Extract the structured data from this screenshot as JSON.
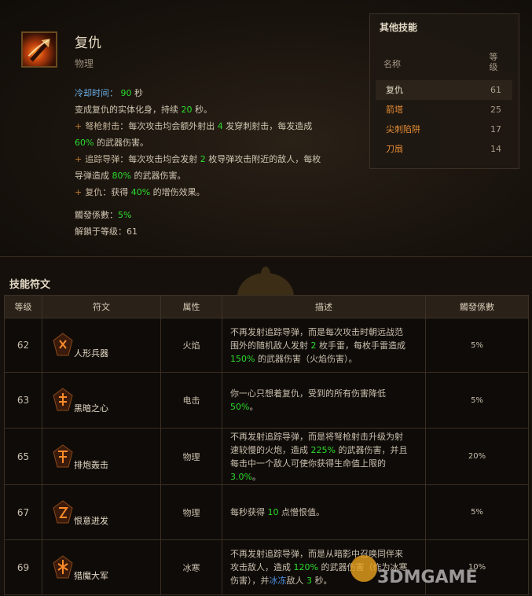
{
  "skill": {
    "name": "复仇",
    "type": "物理",
    "cooldown_label": "冷却时间：",
    "cooldown_value": "90",
    "cooldown_unit": "秒",
    "line1_a": "变成复仇的实体化身，持续",
    "line1_value": "20",
    "line1_b": "秒。",
    "crossbow_name": "弩枪射击",
    "crossbow_a": "：每次攻击均会额外射出",
    "crossbow_value": "4",
    "crossbow_b": "发穿刺射击，每发造成",
    "crossbow_pct": "60%",
    "crossbow_c": "的武器伤害。",
    "homing_name": "追踪导弹",
    "homing_a": "：每次攻击均会发射",
    "homing_value": "2",
    "homing_b": "枚导弹攻击附近的敌人，每枚",
    "homing_c": "导弹造成",
    "homing_pct": "80%",
    "homing_d": "的武器伤害。",
    "vengeance_name": "复仇",
    "vengeance_a": "：获得",
    "vengeance_pct": "40%",
    "vengeance_b": "的增伤效果。",
    "coef_label": "觸發係數：",
    "coef_value": "5%",
    "unlock_label": "解鎖于等级：",
    "unlock_value": "61"
  },
  "other_skills": {
    "title": "其他技能",
    "header_name": "名称",
    "header_level": "等级",
    "items": [
      {
        "name": "复仇",
        "level": "61"
      },
      {
        "name": "箭塔",
        "level": "25"
      },
      {
        "name": "尖刺陷阱",
        "level": "17"
      },
      {
        "name": "刀扇",
        "level": "14"
      }
    ]
  },
  "runes": {
    "title": "技能符文",
    "headers": [
      "等级",
      "符文",
      "属性",
      "描述",
      "觸發係數"
    ],
    "rows": [
      {
        "level": "62",
        "name": "人形兵器",
        "attr": "火焰",
        "coef": "5%",
        "desc": [
          "不再发射追踪导弹，而是每次攻击时朝远战范",
          "围外的随机敌人发射",
          "2",
          "枚手雷，每枚手雷造成",
          "150%",
          "的武器伤害（火焰伤害）。"
        ]
      },
      {
        "level": "63",
        "name": "黑暗之心",
        "attr": "电击",
        "coef": "5%",
        "desc": [
          "你一心只想着复仇，受到的所有伤害降低",
          "50%",
          "。"
        ]
      },
      {
        "level": "65",
        "name": "排炮轰击",
        "attr": "物理",
        "coef": "20%",
        "desc": [
          "不再发射追踪导弹，而是将弩枪射击升级为射",
          "速较慢的火炮，造成",
          "225%",
          "的武器伤害，并且",
          "每击中一个敌人可使你获得生命值上限的",
          "3.0%",
          "。"
        ]
      },
      {
        "level": "67",
        "name": "恨意迸发",
        "attr": "物理",
        "coef": "5%",
        "desc": [
          "每秒获得",
          "10",
          "点憎恨值。"
        ]
      },
      {
        "level": "69",
        "name": "猎魔大军",
        "attr": "冰寒",
        "coef": "10%",
        "desc": [
          "不再发射追踪导弹，而是从暗影中召唤同伴来",
          "攻击敌人，造成",
          "120%",
          "的武器伤害（作为冰寒",
          "伤害），并",
          "冰冻",
          "敌人",
          "3",
          "秒。"
        ]
      }
    ]
  },
  "watermark": "3DMGAME",
  "colors": {
    "accent_orange": "#e38b34",
    "value_green": "#2bdc2b",
    "fire": "#e02020",
    "lightning": "#6a6ae8",
    "cold": "#4a8fe0"
  }
}
